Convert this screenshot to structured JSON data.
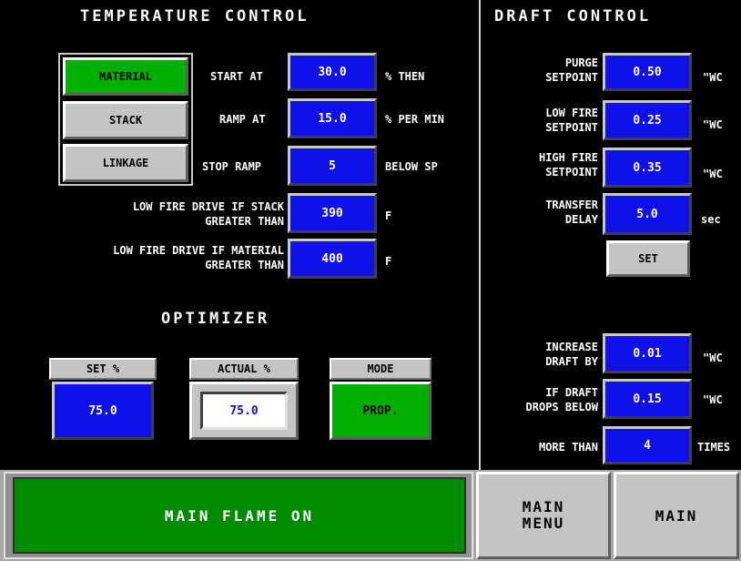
{
  "temperature": {
    "title": "TEMPERATURE CONTROL",
    "buttons": [
      "MATERIAL",
      "STACK",
      "LINKAGE"
    ],
    "start_label": "START AT",
    "start_value": "30.0",
    "start_unit": "% THEN",
    "ramp_label": "RAMP AT",
    "ramp_value": "15.0",
    "ramp_unit": "% PER MIN",
    "stop_label": "STOP RAMP",
    "stop_value": "5",
    "stop_unit": "BELOW SP",
    "stack_label_1": "LOW FIRE DRIVE IF STACK",
    "stack_label_2": "GREATER THAN",
    "stack_value": "390",
    "stack_unit": "F",
    "material_label_1": "LOW FIRE DRIVE IF MATERIAL",
    "material_label_2": "GREATER THAN",
    "material_value": "400",
    "material_unit": "F"
  },
  "optimizer": {
    "title": "OPTIMIZER",
    "set_label": "SET %",
    "set_value": "75.0",
    "actual_label": "ACTUAL %",
    "actual_value": "75.0",
    "mode_label": "MODE",
    "mode_value": "PROP."
  },
  "draft": {
    "title": "DRAFT CONTROL",
    "purge_1": "PURGE",
    "purge_2": "SETPOINT",
    "purge_value": "0.50",
    "purge_unit": "\"WC",
    "low_1": "LOW FIRE",
    "low_2": "SETPOINT",
    "low_value": "0.25",
    "low_unit": "\"WC",
    "high_1": "HIGH FIRE",
    "high_2": "SETPOINT",
    "high_value": "0.35",
    "high_unit": "\"WC",
    "transfer_1": "TRANSFER",
    "transfer_2": "DELAY",
    "transfer_value": "5.0",
    "transfer_unit": "sec",
    "set_button": "SET",
    "increase_1": "INCREASE",
    "increase_2": "DRAFT BY",
    "increase_value": "0.01",
    "increase_unit": "\"WC",
    "drops_1": "IF DRAFT",
    "drops_2": "DROPS BELOW",
    "drops_value": "0.15",
    "drops_unit": "\"WC",
    "more_label": "MORE THAN",
    "more_value": "4",
    "more_unit": "TIMES"
  },
  "footer": {
    "status": "MAIN FLAME ON",
    "main_menu_1": "MAIN",
    "main_menu_2": "MENU",
    "main": "MAIN"
  },
  "colors": {
    "value_blue": "#1010e8",
    "active_green": "#00b000",
    "button_grey": "#c4c4c4"
  }
}
